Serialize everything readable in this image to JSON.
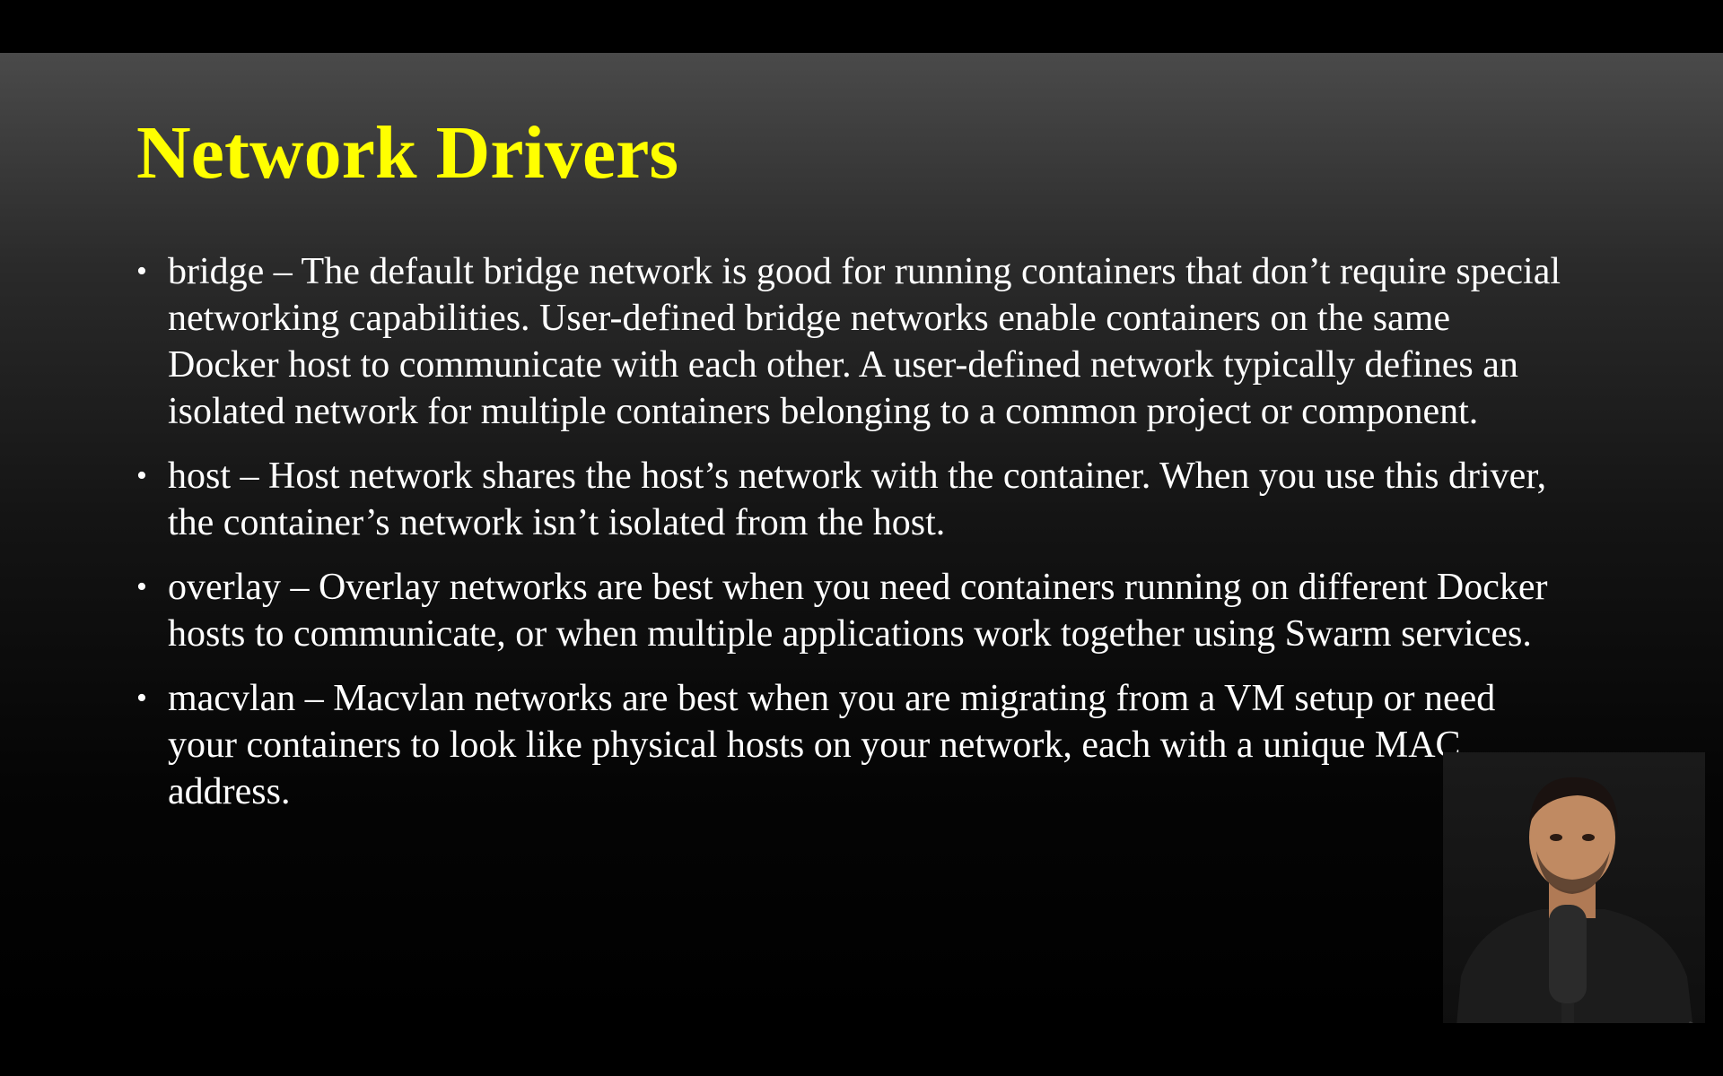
{
  "slide": {
    "title": "Network Drivers",
    "bullet_glyph": "•",
    "bullets": [
      {
        "text": "bridge – The default bridge network is good for running containers that don’t require special networking capabilities. User-defined bridge networks enable containers on the same Docker host to communicate with each other. A user-defined network typically defines an isolated network for multiple containers belonging to a common project or component."
      },
      {
        "text": "host – Host network shares the host’s network with the container. When you use this driver, the container’s network isn’t isolated from the host."
      },
      {
        "text": "overlay – Overlay networks are best when you need containers running on different Docker hosts to communicate, or when multiple applications work together using Swarm services."
      },
      {
        "text": "macvlan – Macvlan networks are best when you are migrating from a VM setup or need your containers to look like physical hosts on your network, each with a unique MAC address."
      }
    ]
  },
  "colors": {
    "title": "#ffff00",
    "text": "#ffffff",
    "letterbox": "#000000"
  }
}
